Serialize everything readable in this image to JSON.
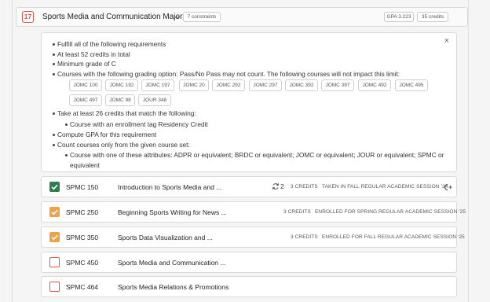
{
  "requirement": {
    "number": "17",
    "title": "Sports Media and Communication Major",
    "constraints_label": "7 constraints",
    "gpa": "GPA 3.223",
    "credits": "35 credits",
    "close_symbol": "×"
  },
  "constraints": {
    "fulfill_all": "Fulfill all of the following requirements",
    "at_least_credits": "At least 52 credits in total",
    "min_grade": "Minimum grade of C",
    "grading_option": "Courses with the following grading option: Pass/No Pass may not count. The following courses will not impact this limit:",
    "excluded_courses": [
      "JOMC 100",
      "JOMC 192",
      "JOMC 197",
      "JOMC 20",
      "JOMC 292",
      "JOMC 297",
      "JOMC 392",
      "JOMC 397",
      "JOMC 492",
      "JOMC 495",
      "JOMC 497",
      "JOMC 98",
      "JOUR 348"
    ],
    "take_at_least": "Take at least 26 credits that match the following:",
    "enrollment_tag": "Course with an enrollment tag Residency Credit",
    "compute_gpa": "Compute GPA for this requirement",
    "count_only": "Count courses only from the given course set:",
    "attributes_line1": "Course with one of these attributes: ADPR or equivalent; BRDC or equivalent; JOMC or equivalent; JOUR or equivalent; SPMC or",
    "attributes_line2": "equivalent"
  },
  "courses": [
    {
      "code": "SPMC 150",
      "name": "Introduction to Sports Media and ...",
      "repeat": "2",
      "credits": "3 CREDITS",
      "status": "TAKEN IN FALL REGULAR ACADEMIC SESSION '24",
      "state": "completed"
    },
    {
      "code": "SPMC 250",
      "name": "Beginning Sports Writing for News ...",
      "credits": "3 CREDITS",
      "status": "ENROLLED FOR SPRING REGULAR ACADEMIC SESSION '25",
      "state": "enrolled"
    },
    {
      "code": "SPMC 350",
      "name": "Sports Data Visualization and ...",
      "credits": "3 CREDITS",
      "status": "ENROLLED FOR FALL REGULAR ACADEMIC SESSION '25",
      "state": "enrolled"
    },
    {
      "code": "SPMC 450",
      "name": "Sports Media and Communication ...",
      "state": "missing"
    },
    {
      "code": "SPMC 464",
      "name": "Sports Media Relations & Promotions",
      "state": "missing"
    }
  ],
  "colors": {
    "completed": "#2e7d4f",
    "enrolled": "#f0a04b",
    "missing": "#d9534f"
  }
}
